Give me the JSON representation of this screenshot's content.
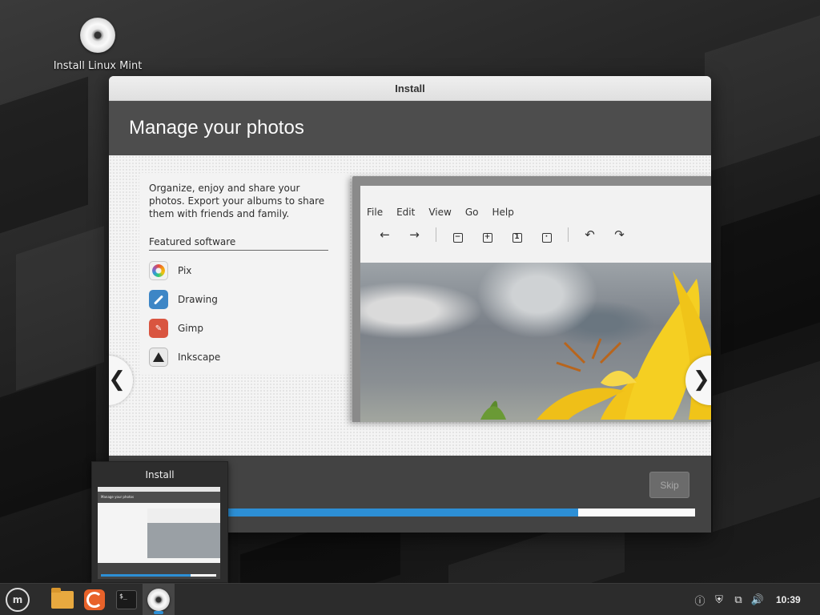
{
  "desktop": {
    "icons": [
      {
        "label": "Install Linux Mint",
        "icon": "disc-icon"
      }
    ]
  },
  "window": {
    "title": "Install",
    "slide_title": "Manage your photos",
    "description": "Organize, enjoy and share your photos. Export your albums to share them with friends and family.",
    "featured_heading": "Featured software",
    "featured_apps": [
      {
        "name": "Pix",
        "icon": "pix-icon"
      },
      {
        "name": "Drawing",
        "icon": "drawing-icon"
      },
      {
        "name": "Gimp",
        "icon": "gimp-icon"
      },
      {
        "name": "Inkscape",
        "icon": "inkscape-icon"
      }
    ],
    "preview": {
      "menu": [
        "File",
        "Edit",
        "View",
        "Go",
        "Help"
      ],
      "toolbar_icons": [
        "back-arrow-icon",
        "forward-arrow-icon",
        "zoom-out-icon",
        "zoom-in-icon",
        "zoom-fit-icon",
        "zoom-original-icon",
        "rotate-left-icon",
        "rotate-right-icon"
      ]
    },
    "prev_arrow": "❮",
    "next_arrow": "❯",
    "skip_label": "Skip",
    "progress": 0.75,
    "accent_color": "#2d8fd5"
  },
  "popup": {
    "title": "Install",
    "thumb_title": "Manage your photos"
  },
  "taskbar": {
    "apps": [
      "mint-menu-icon",
      "files-icon",
      "firefox-icon",
      "terminal-icon",
      "install-disc-icon"
    ],
    "terminal_glyph": "$_",
    "tray": [
      "update-manager-icon",
      "shield-icon",
      "network-icon",
      "volume-icon"
    ],
    "clock": "10:39"
  }
}
